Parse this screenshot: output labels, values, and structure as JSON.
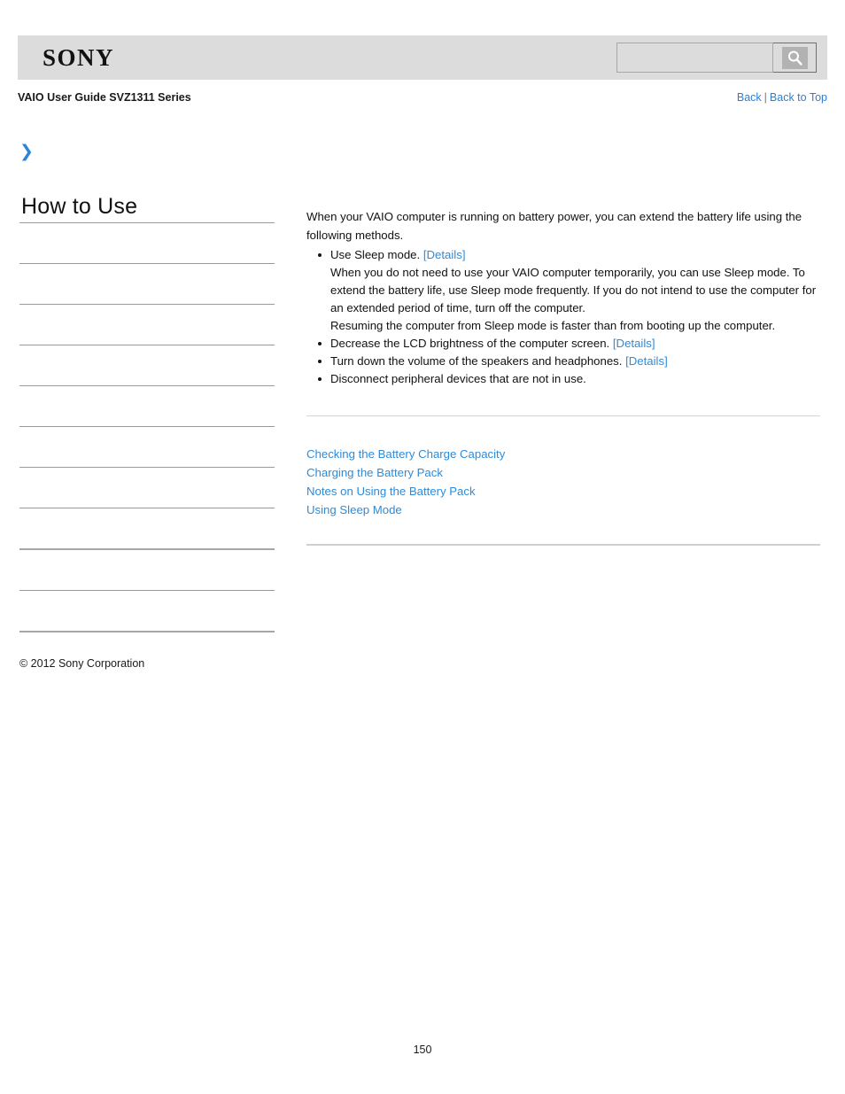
{
  "header": {
    "logo_text": "SONY",
    "search": {
      "value": "",
      "placeholder": "",
      "button_icon": "search-icon"
    }
  },
  "subheader": {
    "guide_title": "VAIO User Guide SVZ1311 Series",
    "back_label": "Back",
    "separator": "|",
    "back_to_top_label": "Back to Top"
  },
  "breadcrumb": {
    "arrow_icon": "chevron-right-icon",
    "arrow_glyph": "❯",
    "text": ""
  },
  "sidebar": {
    "title": "How to Use",
    "items": [
      {
        "label": ""
      },
      {
        "label": ""
      },
      {
        "label": ""
      },
      {
        "label": ""
      },
      {
        "label": ""
      },
      {
        "label": ""
      },
      {
        "label": ""
      },
      {
        "label": ""
      },
      {
        "label": ""
      },
      {
        "label": ""
      }
    ]
  },
  "content": {
    "intro": "When your VAIO computer is running on battery power, you can extend the battery life using the following methods.",
    "methods": [
      {
        "text": "Use Sleep mode.",
        "link_label": "[Details]",
        "detail_lines": [
          "When you do not need to use your VAIO computer temporarily, you can use Sleep mode. To extend the battery life, use Sleep mode frequently. If you do not intend to use the computer for an extended period of time, turn off the computer.",
          "Resuming the computer from Sleep mode is faster than from booting up the computer."
        ]
      },
      {
        "text": "Decrease the LCD brightness of the computer screen.",
        "link_label": "[Details]",
        "detail_lines": []
      },
      {
        "text": "Turn down the volume of the speakers and headphones.",
        "link_label": "[Details]",
        "detail_lines": []
      },
      {
        "text": "Disconnect peripheral devices that are not in use.",
        "link_label": "",
        "detail_lines": []
      }
    ],
    "related_links": [
      "Checking the Battery Charge Capacity",
      "Charging the Battery Pack",
      "Notes on Using the Battery Pack",
      "Using Sleep Mode"
    ]
  },
  "footer": {
    "copyright": "© 2012 Sony Corporation",
    "page_number": "150"
  },
  "colors": {
    "link_blue": "#2e8bd8",
    "nav_blue": "#2b7fd4",
    "header_bg": "#dcdcdc",
    "chevron_blue": "#2b86d9"
  }
}
